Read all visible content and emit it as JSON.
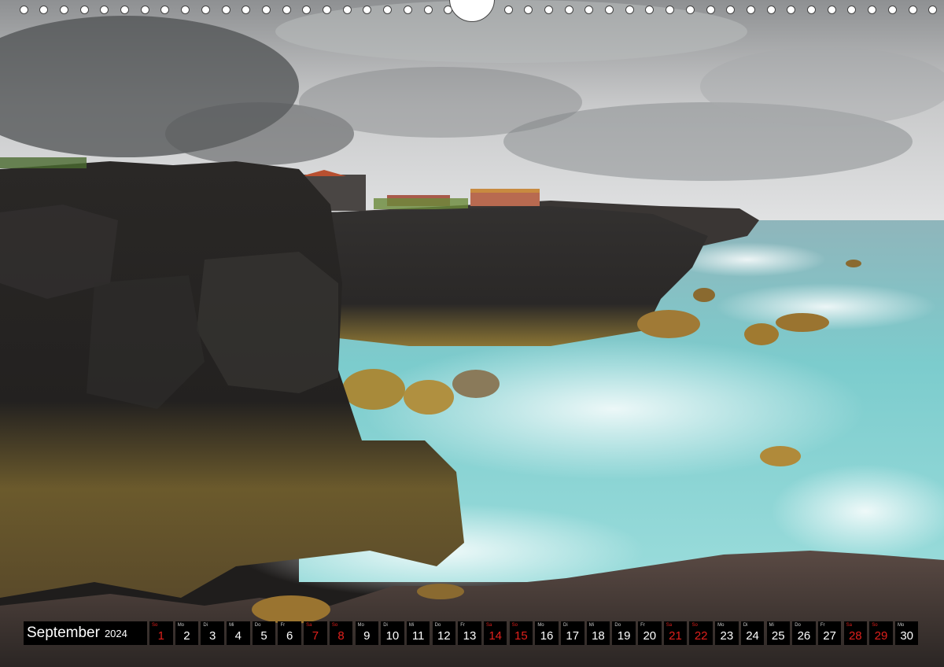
{
  "calendar": {
    "month": "September",
    "year": "2024",
    "days": [
      {
        "dn": "So",
        "num": "1",
        "weekend": true
      },
      {
        "dn": "Mo",
        "num": "2",
        "weekend": false
      },
      {
        "dn": "Di",
        "num": "3",
        "weekend": false
      },
      {
        "dn": "Mi",
        "num": "4",
        "weekend": false
      },
      {
        "dn": "Do",
        "num": "5",
        "weekend": false
      },
      {
        "dn": "Fr",
        "num": "6",
        "weekend": false
      },
      {
        "dn": "Sa",
        "num": "7",
        "weekend": true
      },
      {
        "dn": "So",
        "num": "8",
        "weekend": true
      },
      {
        "dn": "Mo",
        "num": "9",
        "weekend": false
      },
      {
        "dn": "Di",
        "num": "10",
        "weekend": false
      },
      {
        "dn": "Mi",
        "num": "11",
        "weekend": false
      },
      {
        "dn": "Do",
        "num": "12",
        "weekend": false
      },
      {
        "dn": "Fr",
        "num": "13",
        "weekend": false
      },
      {
        "dn": "Sa",
        "num": "14",
        "weekend": true
      },
      {
        "dn": "So",
        "num": "15",
        "weekend": true
      },
      {
        "dn": "Mo",
        "num": "16",
        "weekend": false
      },
      {
        "dn": "Di",
        "num": "17",
        "weekend": false
      },
      {
        "dn": "Mi",
        "num": "18",
        "weekend": false
      },
      {
        "dn": "Do",
        "num": "19",
        "weekend": false
      },
      {
        "dn": "Fr",
        "num": "20",
        "weekend": false
      },
      {
        "dn": "Sa",
        "num": "21",
        "weekend": true
      },
      {
        "dn": "So",
        "num": "22",
        "weekend": true
      },
      {
        "dn": "Mo",
        "num": "23",
        "weekend": false
      },
      {
        "dn": "Di",
        "num": "24",
        "weekend": false
      },
      {
        "dn": "Mi",
        "num": "25",
        "weekend": false
      },
      {
        "dn": "Do",
        "num": "26",
        "weekend": false
      },
      {
        "dn": "Fr",
        "num": "27",
        "weekend": false
      },
      {
        "dn": "Sa",
        "num": "28",
        "weekend": true
      },
      {
        "dn": "So",
        "num": "29",
        "weekend": true
      },
      {
        "dn": "Mo",
        "num": "30",
        "weekend": false
      }
    ]
  },
  "colors": {
    "weekend": "#e0201c",
    "bar": "#000000",
    "sky": "#9a9c9e",
    "sea": "#6fc4c6",
    "rock": "#2d2b2a"
  }
}
